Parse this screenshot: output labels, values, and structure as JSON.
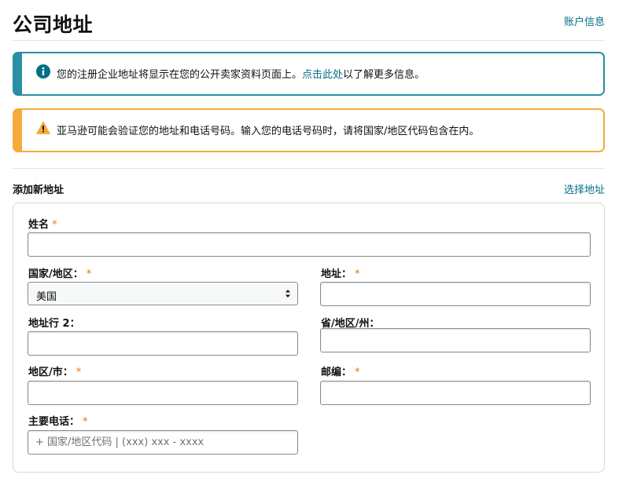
{
  "header": {
    "title": "公司地址",
    "account_link": "账户信息"
  },
  "info_alert": {
    "icon": "info-icon",
    "text_before": "您的注册企业地址将显示在您的公开卖家资料页面上。",
    "link": "点击此处",
    "text_after": "以了解更多信息。"
  },
  "warning_alert": {
    "icon": "warning-icon",
    "text": "亚马逊可能会验证您的地址和电话号码。输入您的电话号码时，请将国家/地区代码包含在内。"
  },
  "section": {
    "title": "添加新地址",
    "select_address_link": "选择地址"
  },
  "form": {
    "full_name": {
      "label": "姓名",
      "required": "*",
      "value": ""
    },
    "country": {
      "label": "国家/地区：",
      "required": "*",
      "value": "美国"
    },
    "address": {
      "label": "地址：",
      "required": "*",
      "value": ""
    },
    "address_line2": {
      "label": "地址行 2：",
      "value": ""
    },
    "state": {
      "label": "省/地区/州：",
      "value": ""
    },
    "city": {
      "label": "地区/市：",
      "required": "*",
      "value": ""
    },
    "postal_code": {
      "label": "邮编：",
      "required": "*",
      "value": ""
    },
    "phone": {
      "label": "主要电话：",
      "required": "*",
      "value": "",
      "placeholder": "+ 国家/地区代码 | (xxx) xxx - xxxx"
    }
  },
  "colors": {
    "link": "#007185",
    "info_border": "#2a8fa3",
    "warning_border": "#f5ab3b",
    "required_mark": "#e77600"
  }
}
